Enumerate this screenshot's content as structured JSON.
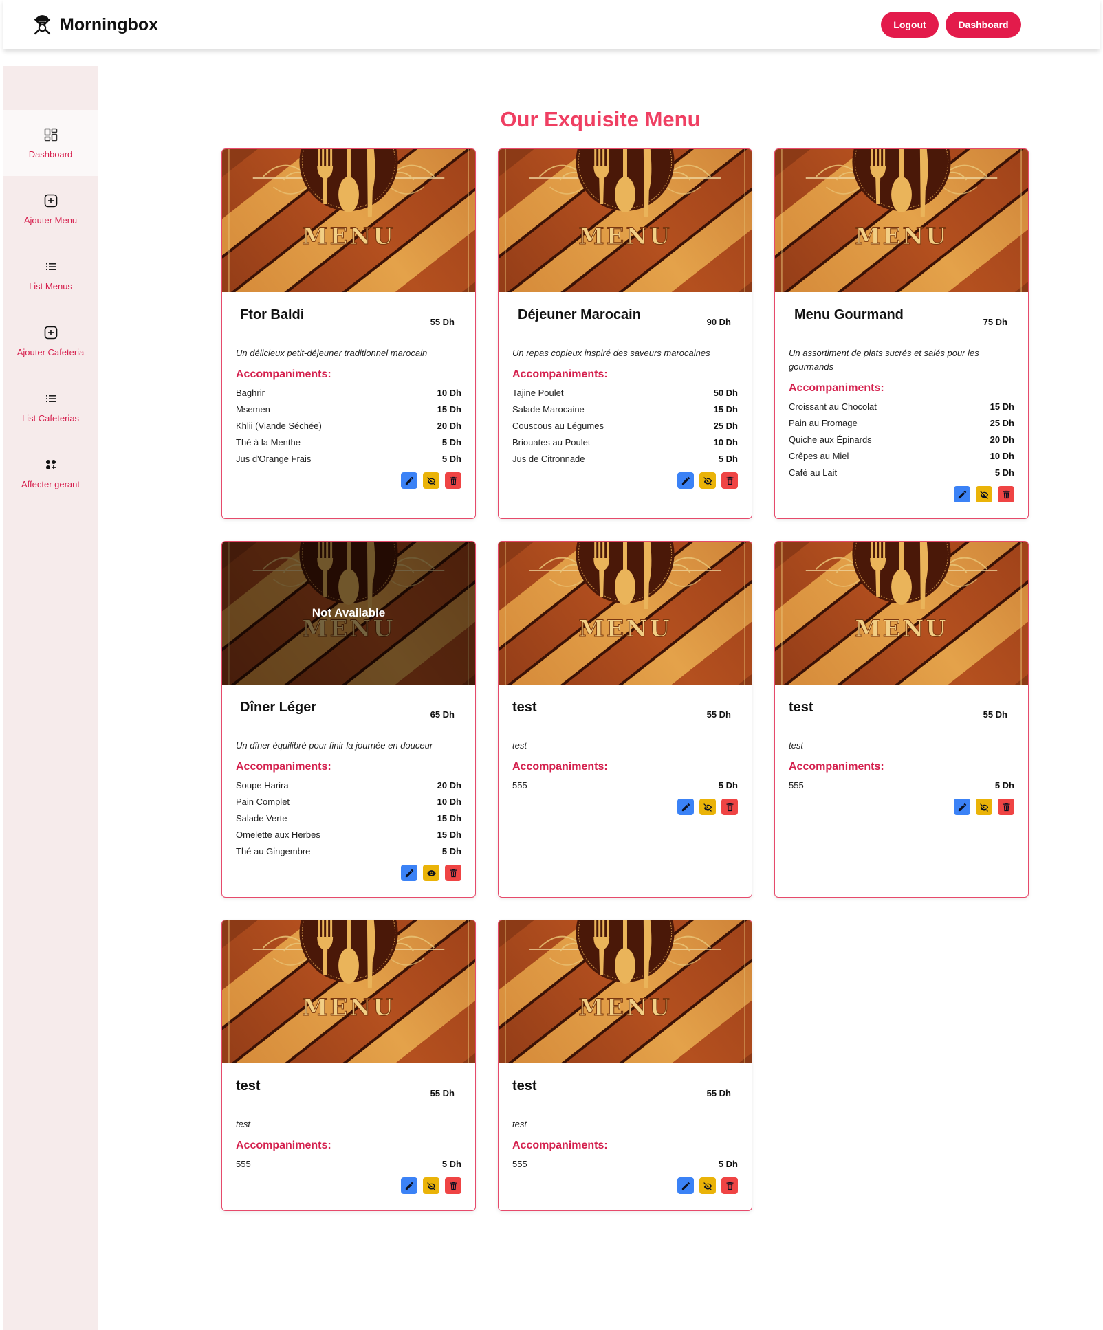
{
  "header": {
    "brand": "Morningbox",
    "logout_label": "Logout",
    "dashboard_label": "Dashboard"
  },
  "sidebar": {
    "items": [
      {
        "label": "Dashboard",
        "icon": "dashboard-grid-icon"
      },
      {
        "label": "Ajouter Menu",
        "icon": "plus-square-icon"
      },
      {
        "label": "List Menus",
        "icon": "list-icon"
      },
      {
        "label": "Ajouter Cafeteria",
        "icon": "plus-square-icon"
      },
      {
        "label": "List Cafeterias",
        "icon": "list-icon"
      },
      {
        "label": "Affecter gerant",
        "icon": "apps-add-icon"
      }
    ]
  },
  "main": {
    "title": "Our Exquisite Menu",
    "accompaniments_label": "Accompaniments:",
    "menus": [
      {
        "name": "Ftor Baldi",
        "price": "55 Dh",
        "description": "Un délicieux petit-déjeuner traditionnel marocain",
        "available": true,
        "items": [
          {
            "name": "Baghrir",
            "price": "10 Dh"
          },
          {
            "name": "Msemen",
            "price": "15 Dh"
          },
          {
            "name": "Khlii (Viande Séchée)",
            "price": "20 Dh"
          },
          {
            "name": "Thé à la Menthe",
            "price": "5 Dh"
          },
          {
            "name": "Jus d'Orange Frais",
            "price": "5 Dh"
          }
        ]
      },
      {
        "name": "Déjeuner Marocain",
        "price": "90 Dh",
        "description": "Un repas copieux inspiré des saveurs marocaines",
        "available": true,
        "items": [
          {
            "name": "Tajine Poulet",
            "price": "50 Dh"
          },
          {
            "name": "Salade Marocaine",
            "price": "15 Dh"
          },
          {
            "name": "Couscous au Légumes",
            "price": "25 Dh"
          },
          {
            "name": "Briouates au Poulet",
            "price": "10 Dh"
          },
          {
            "name": "Jus de Citronnade",
            "price": "5 Dh"
          }
        ]
      },
      {
        "name": "Menu Gourmand",
        "price": "75 Dh",
        "description": "Un assortiment de plats sucrés et salés pour les gourmands",
        "available": true,
        "items": [
          {
            "name": "Croissant au Chocolat",
            "price": "15 Dh"
          },
          {
            "name": "Pain au Fromage",
            "price": "25 Dh"
          },
          {
            "name": "Quiche aux Épinards",
            "price": "20 Dh"
          },
          {
            "name": "Crêpes au Miel",
            "price": "10 Dh"
          },
          {
            "name": "Café au Lait",
            "price": "5 Dh"
          }
        ]
      },
      {
        "name": "Dîner Léger",
        "price": "65 Dh",
        "description": "Un dîner équilibré pour finir la journée en douceur",
        "available": false,
        "unavailable_label": "Not Available",
        "items": [
          {
            "name": "Soupe Harira",
            "price": "20 Dh"
          },
          {
            "name": "Pain Complet",
            "price": "10 Dh"
          },
          {
            "name": "Salade Verte",
            "price": "15 Dh"
          },
          {
            "name": "Omelette aux Herbes",
            "price": "15 Dh"
          },
          {
            "name": "Thé au Gingembre",
            "price": "5 Dh"
          }
        ]
      },
      {
        "name": "test",
        "price": "55 Dh",
        "description": "test",
        "available": true,
        "items": [
          {
            "name": "555",
            "price": "5 Dh"
          }
        ]
      },
      {
        "name": "test",
        "price": "55 Dh",
        "description": "test",
        "available": true,
        "items": [
          {
            "name": "555",
            "price": "5 Dh"
          }
        ]
      },
      {
        "name": "test",
        "price": "55 Dh",
        "description": "test",
        "available": true,
        "items": [
          {
            "name": "555",
            "price": "5 Dh"
          }
        ]
      },
      {
        "name": "test",
        "price": "55 Dh",
        "description": "test",
        "available": true,
        "items": [
          {
            "name": "555",
            "price": "5 Dh"
          }
        ]
      }
    ]
  },
  "colors": {
    "accent": "#e31b4b",
    "title": "#ef3f62",
    "sidebar_bg": "#f6ebeb",
    "edit": "#3b82f6",
    "visibility": "#eab308",
    "delete": "#ef4444"
  }
}
